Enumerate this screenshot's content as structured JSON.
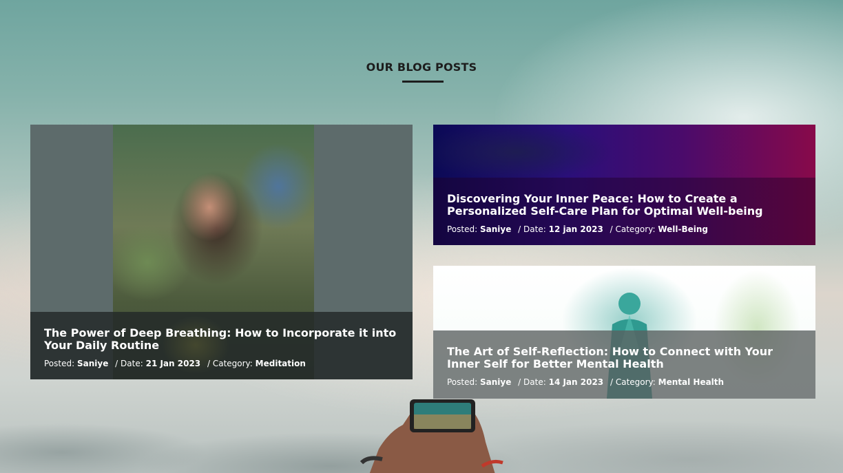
{
  "section": {
    "title": "OUR BLOG POSTS"
  },
  "posts": [
    {
      "title": "The Power of Deep Breathing: How to Incorporate it into Your Daily Routine",
      "posted_label": "Posted:",
      "author": "Saniye",
      "date_label": "/ Date:",
      "date": "21 Jan 2023",
      "category_label": "/ Category:",
      "category": "Meditation"
    },
    {
      "title": "Discovering Your Inner Peace: How to Create a Personalized Self-Care Plan for Optimal Well-being",
      "posted_label": "Posted:",
      "author": "Saniye",
      "date_label": "/ Date:",
      "date": "12 jan 2023",
      "category_label": "/ Category:",
      "category": "Well-Being"
    },
    {
      "title": "The Art of Self-Reflection: How to Connect with Your Inner Self for Better Mental Health",
      "posted_label": "Posted:",
      "author": "Saniye",
      "date_label": "/ Date:",
      "date": "14 Jan 2023",
      "category_label": "/ Category:",
      "category": "Mental Health"
    }
  ],
  "colors": {
    "title": "#1d1d1d",
    "overlay_text": "#ffffff"
  }
}
